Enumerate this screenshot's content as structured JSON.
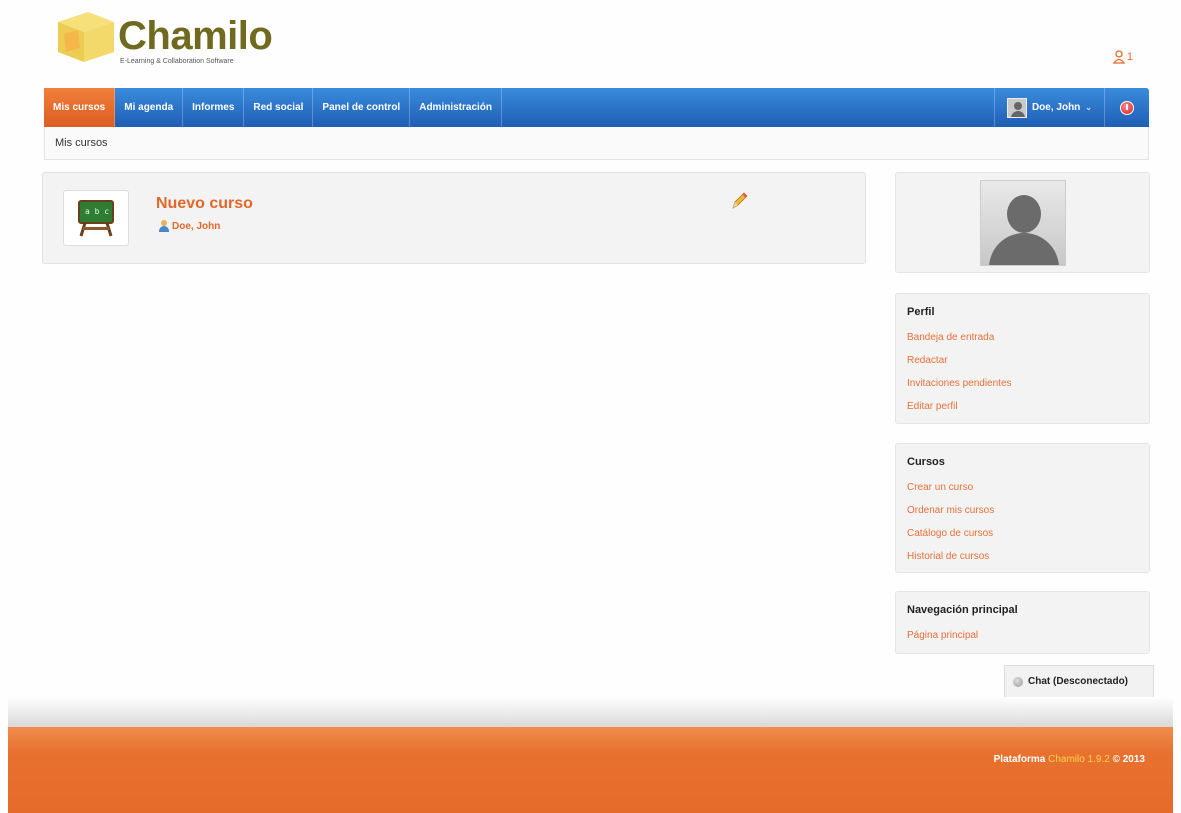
{
  "header": {
    "logo_text": "Chamilo",
    "logo_subtitle": "E-Learning & Collaboration Software",
    "online_count": "1"
  },
  "nav": {
    "items": [
      {
        "label": "Mis cursos",
        "active": true
      },
      {
        "label": "Mi agenda",
        "active": false
      },
      {
        "label": "Informes",
        "active": false
      },
      {
        "label": "Red social",
        "active": false
      },
      {
        "label": "Panel de control",
        "active": false
      },
      {
        "label": "Administración",
        "active": false
      }
    ],
    "user_name": "Doe, John",
    "user_caret": "⌄"
  },
  "breadcrumb": {
    "current": "Mis cursos"
  },
  "course": {
    "title": "Nuevo curso",
    "teacher": "Doe, John",
    "thumb_icon": "blackboard-icon",
    "edit_icon": "pencil-icon"
  },
  "sidebar": {
    "perfil": {
      "title": "Perfil",
      "links": [
        "Bandeja de entrada",
        "Redactar",
        "Invitaciones pendientes",
        "Editar perfil"
      ]
    },
    "cursos": {
      "title": "Cursos",
      "links": [
        "Crear un curso",
        "Ordenar mis cursos",
        "Catálogo de cursos",
        "Historial de cursos"
      ]
    },
    "navegacion": {
      "title": "Navegación principal",
      "links": [
        "Página principal"
      ]
    }
  },
  "chat": {
    "label": "Chat (Desconectado)"
  },
  "footer": {
    "prefix": "Plataforma",
    "brand": "Chamilo 1.9.2",
    "suffix": "© 2013"
  },
  "colors": {
    "nav_blue": "#2b73ca",
    "active_orange": "#e8692a",
    "link_orange": "#e6703a",
    "footer_orange": "#e8712f"
  }
}
